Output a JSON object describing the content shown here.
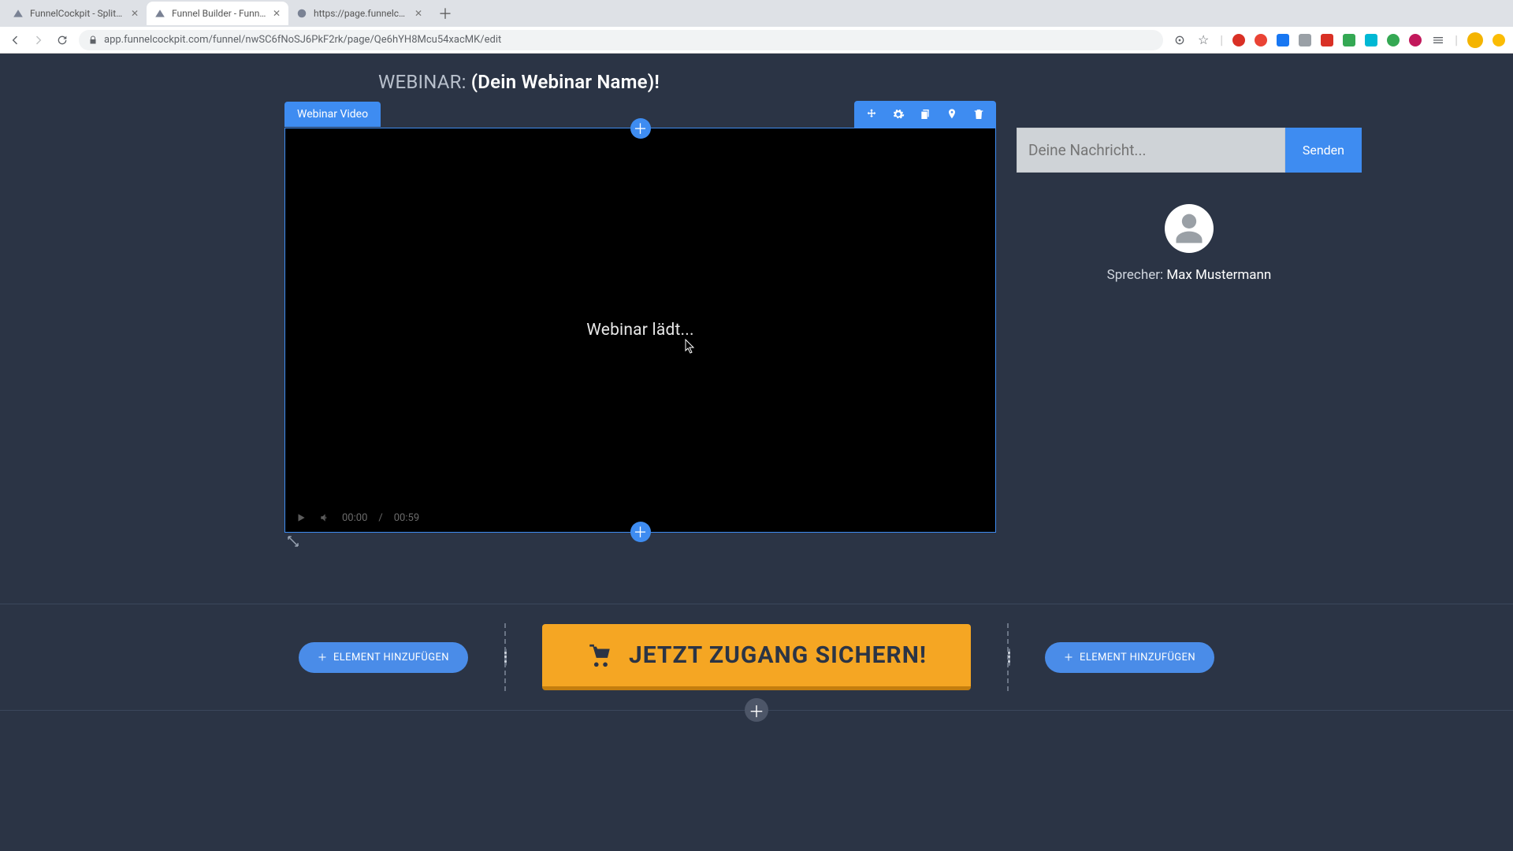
{
  "browser": {
    "tabs": [
      {
        "title": "FunnelCockpit - Splittests, Ma"
      },
      {
        "title": "Funnel Builder - FunnelCockpit"
      },
      {
        "title": "https://page.funnelcockpit.co"
      }
    ],
    "url": "app.funnelcockpit.com/funnel/nwSC6fNoSJ6PkF2rk/page/Qe6hYH8Mcu54xacMK/edit"
  },
  "title": {
    "prefix": "WEBINAR:",
    "name": "(Dein Webinar Name)!"
  },
  "video": {
    "label": "Webinar Video",
    "status": "Webinar lädt...",
    "time_current": "00:00",
    "time_sep": "/",
    "time_total": "00:59"
  },
  "chat": {
    "placeholder": "Deine Nachricht...",
    "send": "Senden"
  },
  "speaker": {
    "label": "Sprecher: ",
    "name": "Max Mustermann"
  },
  "cta": {
    "main": "JETZT ZUGANG SICHERN!",
    "add_element": "ELEMENT HINZUFÜGEN"
  }
}
